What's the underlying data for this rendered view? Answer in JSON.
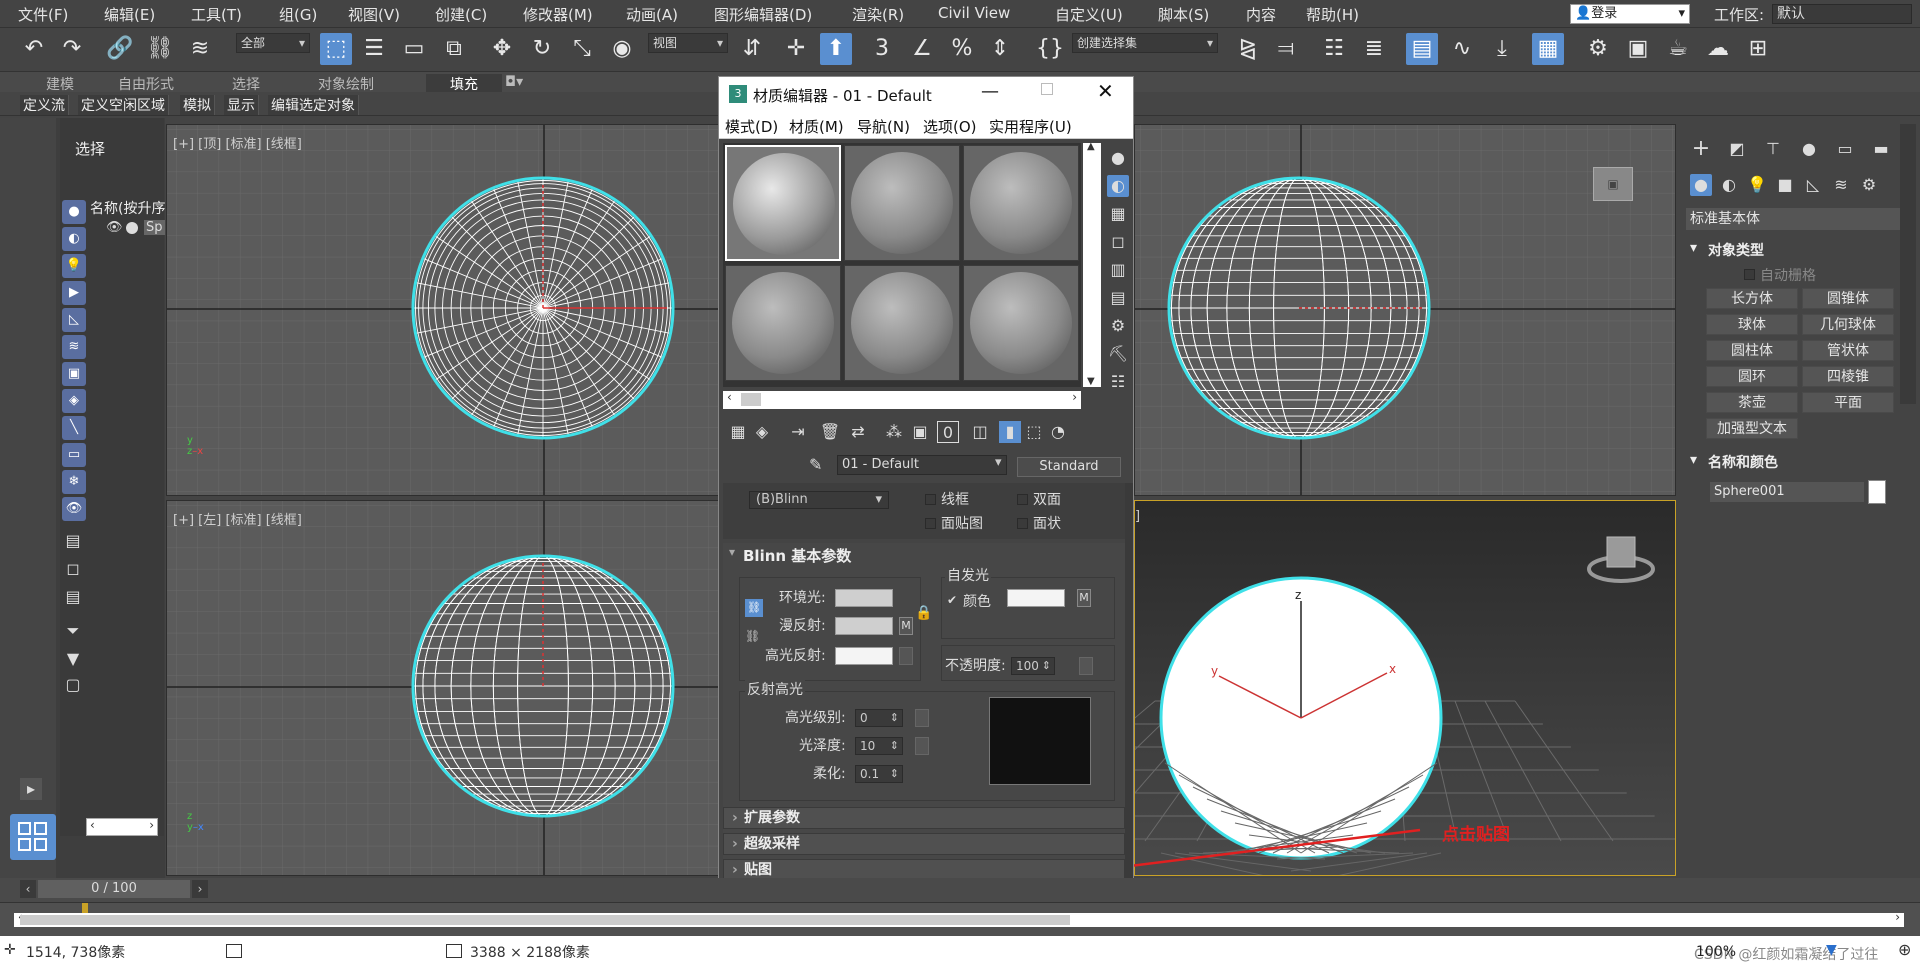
{
  "menubar": {
    "items": [
      "文件(F)",
      "编辑(E)",
      "工具(T)",
      "组(G)",
      "视图(V)",
      "创建(C)",
      "修改器(M)",
      "动画(A)",
      "图形编辑器(D)",
      "渲染(R)",
      "Civil View",
      "自定义(U)",
      "脚本(S)",
      "内容",
      "帮助(H)"
    ],
    "login": "登录",
    "workspace_label": "工作区:",
    "workspace_value": "默认"
  },
  "toolbar": {
    "filter_value": "全部",
    "refcoord_value": "视图",
    "selset_value": "创建选择集"
  },
  "ribbon": {
    "tabs": [
      "建模",
      "自由形式",
      "选择",
      "对象绘制",
      "填充"
    ]
  },
  "subribbon": {
    "items": [
      "定义流",
      "定义空闲区域",
      "模拟",
      "显示",
      "编辑选定对象"
    ]
  },
  "explorer": {
    "title": "选择",
    "column_name": "名称(按升序",
    "row_name": "Sp"
  },
  "viewports": {
    "top_label": "[+] [顶] [标准] [线框]",
    "left_label": "[+] [左] [标准] [线框]",
    "persp_label": "]"
  },
  "material_editor": {
    "title": "材质编辑器 - 01 - Default",
    "menu": [
      "模式(D)",
      "材质(M)",
      "导航(N)",
      "选项(O)",
      "实用程序(U)"
    ],
    "material_name": "01 - Default",
    "material_type": "Standard",
    "shader": "(B)Blinn",
    "options": [
      "线框",
      "双面",
      "面贴图",
      "面状"
    ],
    "blinn_rollout": "Blinn 基本参数",
    "self_illum_group": "自发光",
    "self_illum_color_label": "颜色",
    "ambient_label": "环境光:",
    "diffuse_label": "漫反射:",
    "specular_label": "高光反射:",
    "lock_letter": "M",
    "opacity_label": "不透明度:",
    "opacity_value": "100",
    "spec_group": "反射高光",
    "spec_level_label": "高光级别:",
    "spec_level_value": "0",
    "gloss_label": "光泽度:",
    "gloss_value": "10",
    "soften_label": "柔化:",
    "soften_value": "0.1",
    "rollouts": [
      "扩展参数",
      "超级采样",
      "贴图"
    ]
  },
  "annotation": {
    "text": "点击贴图",
    "color": "#e02020"
  },
  "command_panel": {
    "category": "标准基本体",
    "object_type_title": "对象类型",
    "autogrid": "自动栅格",
    "buttons": [
      "长方体",
      "圆锥体",
      "球体",
      "几何球体",
      "圆柱体",
      "管状体",
      "圆环",
      "四棱锥",
      "茶壶",
      "平面",
      "加强型文本"
    ],
    "name_color_title": "名称和颜色",
    "object_name": "Sphere001"
  },
  "timeline": {
    "frame": "0 / 100"
  },
  "statusbar": {
    "coords": "1514, 738像素",
    "size": "3388 × 2188像素",
    "zoom": "100%",
    "watermark": "CSDN @红颜如霜凝结了过往"
  },
  "colors": {
    "accent": "#5a8fd0",
    "selection_cyan": "#3fe0e8",
    "annotation_red": "#e02020"
  }
}
